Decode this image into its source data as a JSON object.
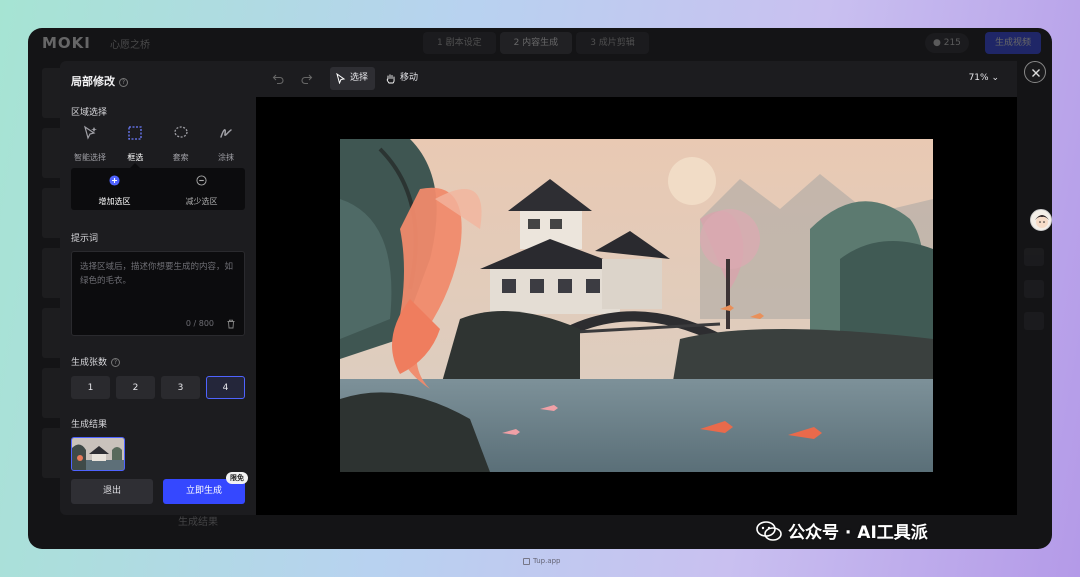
{
  "background_app": {
    "logo": "MOKI",
    "breadcrumb": "心愿之桥",
    "steps": [
      "1 剧本设定",
      "2 内容生成",
      "3 成片剪辑"
    ],
    "credits": "215",
    "generate_video": "生成视频",
    "bottom_label": "生成结果"
  },
  "panel": {
    "title": "局部修改",
    "region_label": "区域选择",
    "tools": [
      {
        "label": "智能选择",
        "icon": "smart-select-icon",
        "active": false
      },
      {
        "label": "框选",
        "icon": "box-select-icon",
        "active": true
      },
      {
        "label": "套索",
        "icon": "lasso-icon",
        "active": false
      },
      {
        "label": "涂抹",
        "icon": "brush-icon",
        "active": false
      }
    ],
    "modes": [
      {
        "label": "增加选区",
        "icon": "plus-circle-icon",
        "active": true
      },
      {
        "label": "减少选区",
        "icon": "minus-circle-icon",
        "active": false
      }
    ],
    "prompt_label": "提示词",
    "prompt_placeholder": "选择区域后，描述你想要生成的内容，如绿色的毛衣。",
    "prompt_value": "",
    "counter": "0 / 800",
    "count_label": "生成张数",
    "counts": [
      "1",
      "2",
      "3",
      "4"
    ],
    "selected_count": "4",
    "result_label": "生成结果",
    "exit_label": "退出",
    "generate_label": "立即生成",
    "free_badge": "限免"
  },
  "toolbar": {
    "select_label": "选择",
    "move_label": "移动",
    "zoom": "71%"
  },
  "watermark": {
    "text": "公众号 · AI工具派"
  },
  "footer": {
    "tag": "Tup.app"
  },
  "colors": {
    "accent": "#3548ff",
    "panel_bg": "#1c1c1f"
  }
}
